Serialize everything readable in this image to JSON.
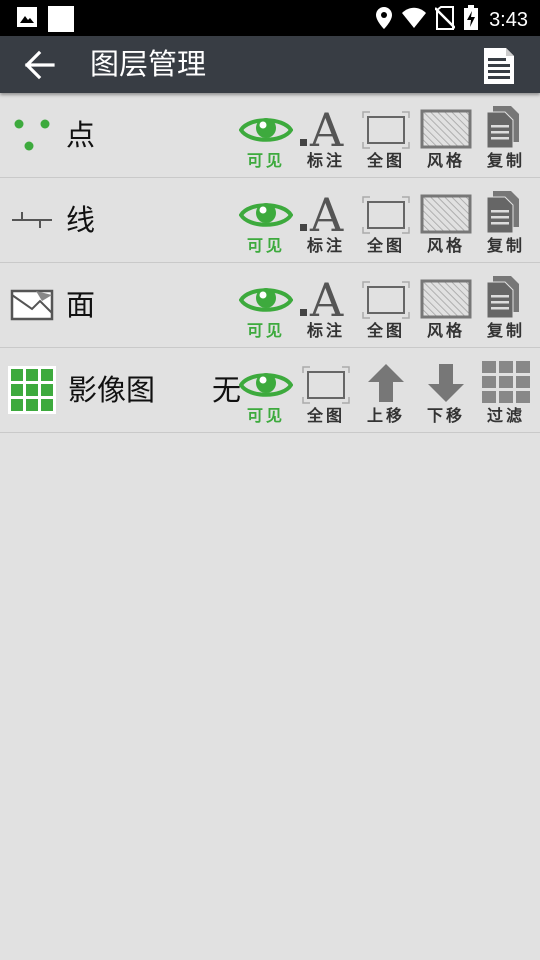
{
  "status_bar": {
    "time": "3:43",
    "icons": [
      "image-icon",
      "square-icon",
      "location-icon",
      "wifi-icon",
      "no-sim-icon",
      "battery-charging-icon"
    ]
  },
  "app_bar": {
    "title": "图层管理",
    "back_icon": "back-arrow-icon",
    "action_icon": "document-list-icon"
  },
  "colors": {
    "accent_green": "#3daa3d",
    "app_bar": "#383d44",
    "background": "#e1e1e1"
  },
  "layers": [
    {
      "name": "点",
      "icon": "point-layer-icon",
      "tools": [
        {
          "label": "可见",
          "icon": "eye-icon"
        },
        {
          "label": "标注",
          "icon": "label-a-icon"
        },
        {
          "label": "全图",
          "icon": "full-extent-icon"
        },
        {
          "label": "风格",
          "icon": "style-hatch-icon"
        },
        {
          "label": "复制",
          "icon": "copy-icon"
        }
      ]
    },
    {
      "name": "线",
      "icon": "line-layer-icon",
      "tools": [
        {
          "label": "可见",
          "icon": "eye-icon"
        },
        {
          "label": "标注",
          "icon": "label-a-icon"
        },
        {
          "label": "全图",
          "icon": "full-extent-icon"
        },
        {
          "label": "风格",
          "icon": "style-hatch-icon"
        },
        {
          "label": "复制",
          "icon": "copy-icon"
        }
      ]
    },
    {
      "name": "面",
      "icon": "polygon-layer-icon",
      "tools": [
        {
          "label": "可见",
          "icon": "eye-icon"
        },
        {
          "label": "标注",
          "icon": "label-a-icon"
        },
        {
          "label": "全图",
          "icon": "full-extent-icon"
        },
        {
          "label": "风格",
          "icon": "style-hatch-icon"
        },
        {
          "label": "复制",
          "icon": "copy-icon"
        }
      ]
    },
    {
      "name": "影像图",
      "extra": "无",
      "icon": "raster-grid-icon",
      "tools": [
        {
          "label": "可见",
          "icon": "eye-icon"
        },
        {
          "label": "全图",
          "icon": "full-extent-icon"
        },
        {
          "label": "上移",
          "icon": "arrow-up-icon"
        },
        {
          "label": "下移",
          "icon": "arrow-down-icon"
        },
        {
          "label": "过滤",
          "icon": "filter-grid-icon"
        }
      ]
    }
  ]
}
